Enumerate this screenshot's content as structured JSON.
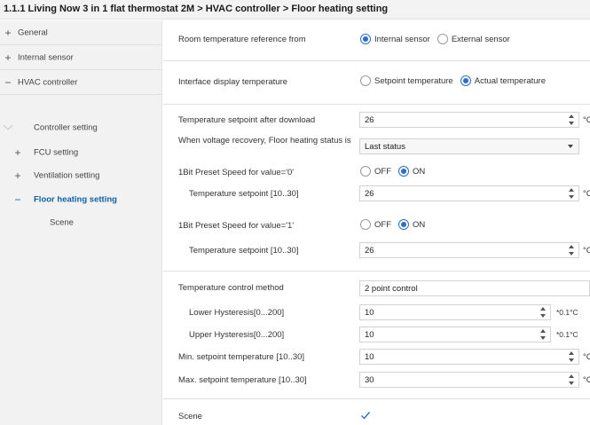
{
  "window": {
    "title": "1.1.1 Living Now 3 in 1 flat thermostat 2M > HVAC controller > Floor heating setting"
  },
  "sidebar": {
    "items": [
      {
        "label": "General",
        "symbol": "+"
      },
      {
        "label": "Internal sensor",
        "symbol": "+"
      },
      {
        "label": "HVAC controller",
        "symbol": "−"
      },
      {
        "label": "Controller setting",
        "symbol": ""
      },
      {
        "label": "FCU setting",
        "symbol": "+"
      },
      {
        "label": "Ventilation setting",
        "symbol": "+"
      },
      {
        "label": "Floor heating setting",
        "symbol": "−"
      },
      {
        "label": "Scene",
        "symbol": ""
      }
    ]
  },
  "main": {
    "room_ref": {
      "label": "Room temperature reference from",
      "options": [
        "Internal sensor",
        "External sensor"
      ]
    },
    "display_temp": {
      "label": "Interface display temperature",
      "options": [
        "Setpoint temperature",
        "Actual temperature"
      ]
    },
    "setpoint_download": {
      "label": "Temperature setpoint after download",
      "value": "26",
      "unit": "°C"
    },
    "voltage_recovery": {
      "label": "When voltage recovery, Floor heating status is",
      "value": "Last status"
    },
    "preset0": {
      "label": "1Bit Preset Speed for value='0'",
      "options": [
        "OFF",
        "ON"
      ]
    },
    "preset0_setpoint": {
      "label": "Temperature setpoint [10..30]",
      "value": "26",
      "unit": "°C"
    },
    "preset1": {
      "label": "1Bit Preset Speed for value='1'",
      "options": [
        "OFF",
        "ON"
      ]
    },
    "preset1_setpoint": {
      "label": "Temperature setpoint [10..30]",
      "value": "26",
      "unit": "°C"
    },
    "control_method": {
      "label": "Temperature control method",
      "value": "2 point control"
    },
    "lower_hyst": {
      "label": "Lower Hysteresis[0...200]",
      "value": "10",
      "unit": "*0.1°C"
    },
    "upper_hyst": {
      "label": "Upper Hysteresis[0...200]",
      "value": "10",
      "unit": "*0.1°C"
    },
    "min_setpoint": {
      "label": "Min. setpoint temperature [10..30]",
      "value": "10",
      "unit": "°C"
    },
    "max_setpoint": {
      "label": "Max. setpoint temperature [10..30]",
      "value": "30",
      "unit": "°C"
    },
    "scene": {
      "label": "Scene",
      "checked": true
    }
  },
  "colors": {
    "accent": "#2b6fc4",
    "active_nav": "#0f5fa8"
  }
}
